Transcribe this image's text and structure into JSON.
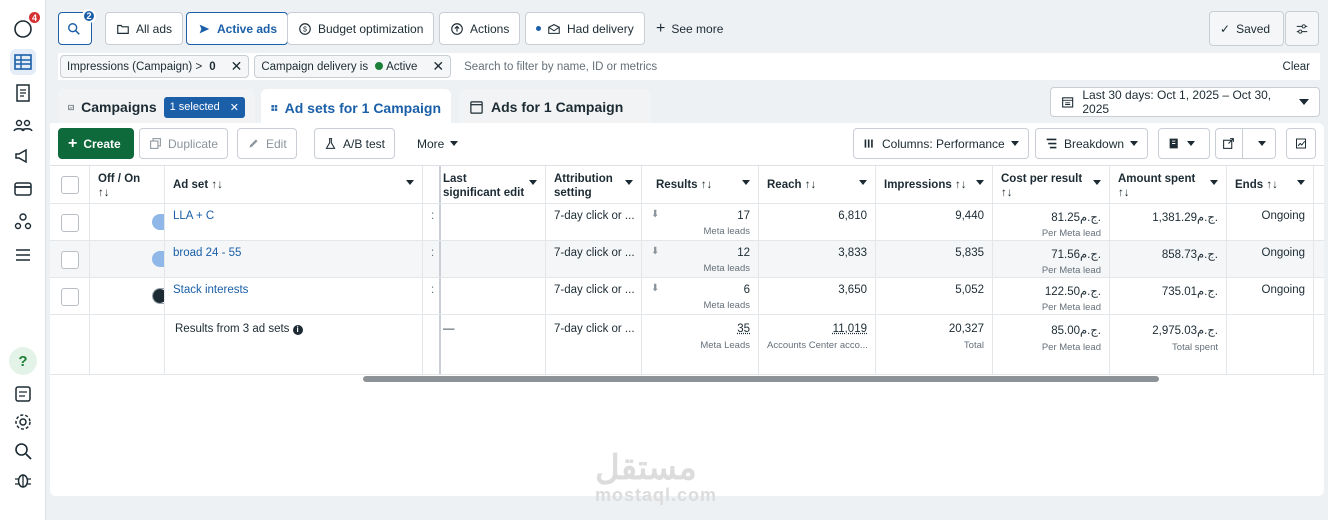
{
  "rail": {
    "notif_count": "4"
  },
  "topbar": {
    "search_count": "2",
    "all_ads": "All ads",
    "active_ads": "Active ads",
    "budget": "Budget optimization",
    "actions": "Actions",
    "had_delivery": "Had delivery",
    "see_more": "See more",
    "saved": "Saved"
  },
  "filters": {
    "chip1_label": "Impressions (Campaign) >",
    "chip1_value": "0",
    "chip2_label": "Campaign delivery is",
    "chip2_value": "Active",
    "search_placeholder": "Search to filter by name, ID or metrics",
    "clear": "Clear"
  },
  "tabs": {
    "campaigns": "Campaigns",
    "selected": "1 selected",
    "adsets": "Ad sets for 1 Campaign",
    "ads": "Ads for 1 Campaign"
  },
  "date_range": "Last 30 days: Oct 1, 2025 – Oct 30, 2025",
  "toolbar": {
    "create": "Create",
    "duplicate": "Duplicate",
    "edit": "Edit",
    "ab_test": "A/B test",
    "more": "More",
    "columns": "Columns: Performance",
    "breakdown": "Breakdown"
  },
  "table": {
    "headers": {
      "offon": "Off / On",
      "adset": "Ad set",
      "last_edit": "Last significant edit",
      "attribution": "Attribution setting",
      "results": "Results",
      "reach": "Reach",
      "impressions": "Impressions",
      "cost": "Cost per result",
      "amount": "Amount spent",
      "ends": "Ends"
    },
    "rows": [
      {
        "on": true,
        "name": "LLA + C",
        "attribution": "7-day click or ...",
        "results": "17",
        "results_sub": "Meta leads",
        "reach": "6,810",
        "impressions": "9,440",
        "cost": "81.25ج.م.",
        "cost_sub": "Per Meta lead",
        "amount": "1,381.29ج.م.",
        "ends": "Ongoing"
      },
      {
        "on": true,
        "name": "broad 24 - 55",
        "attribution": "7-day click or ...",
        "results": "12",
        "results_sub": "Meta leads",
        "reach": "3,833",
        "impressions": "5,835",
        "cost": "71.56ج.م.",
        "cost_sub": "Per Meta lead",
        "amount": "858.73ج.م.",
        "ends": "Ongoing"
      },
      {
        "on": false,
        "name": "Stack interests",
        "attribution": "7-day click or ...",
        "results": "6",
        "results_sub": "Meta leads",
        "reach": "3,650",
        "impressions": "5,052",
        "cost": "122.50ج.م.",
        "cost_sub": "Per Meta lead",
        "amount": "735.01ج.م.",
        "ends": "Ongoing"
      }
    ],
    "summary": {
      "label": "Results from 3 ad sets",
      "last_edit": "—",
      "attribution": "7-day click or ...",
      "results": "35",
      "results_sub": "Meta Leads",
      "reach": "11,019",
      "reach_sub": "Accounts Center acco...",
      "impressions": "20,327",
      "impressions_sub": "Total",
      "cost": "85.00ج.م.",
      "cost_sub": "Per Meta lead",
      "amount": "2,975.03ج.م.",
      "amount_sub": "Total spent"
    }
  },
  "watermark": {
    "arabic": "مستقل",
    "latin": "mostaql.com"
  }
}
